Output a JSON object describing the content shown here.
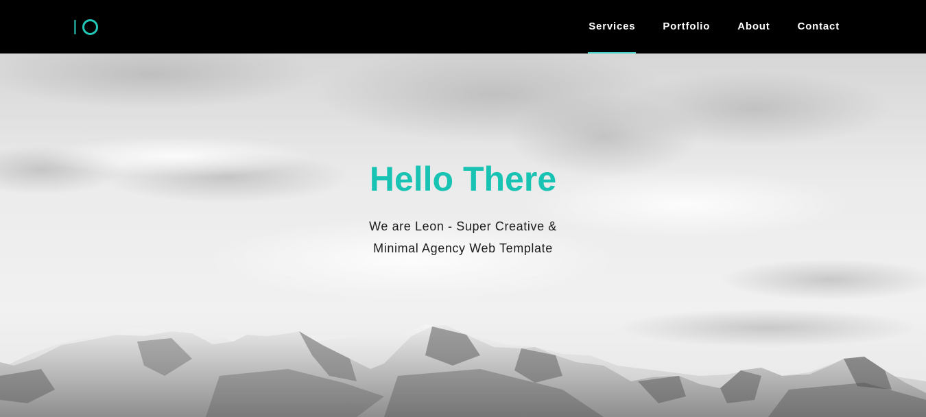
{
  "header": {
    "logo_icon": "io-logo-icon",
    "nav": [
      {
        "label": "Services",
        "active": true
      },
      {
        "label": "Portfolio",
        "active": false
      },
      {
        "label": "About",
        "active": false
      },
      {
        "label": "Contact",
        "active": false
      }
    ]
  },
  "hero": {
    "title": "Hello There",
    "subtitle": "We are Leon - Super Creative & Minimal Agency Web Template",
    "background": "snowy-mountains-cloudy-sky-image"
  },
  "colors": {
    "accent": "#19c3b4",
    "nav_underline": "#45d3c7",
    "header_bg": "#000000",
    "nav_text": "#ffffff",
    "subtitle_text": "#1c1c1c"
  }
}
